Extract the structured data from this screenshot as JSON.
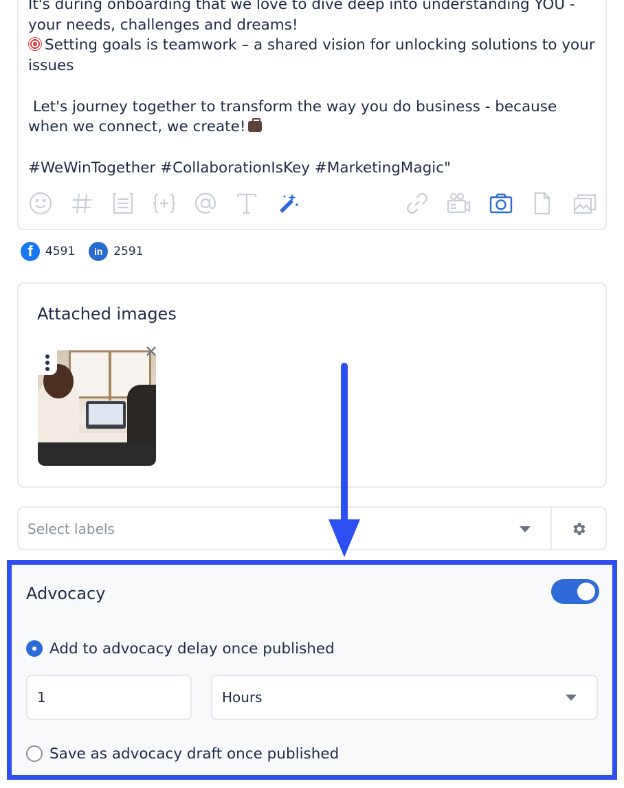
{
  "composer": {
    "text": "It's during onboarding that we love to dive deep into understanding YOU - your needs, challenges and dreams!\n",
    "goal_line": "Setting goals is teamwork – a shared vision for unlocking solutions to your issues\n\n Let's journey together to transform the way you do business - because when we connect, we create!",
    "hashtags": "#WeWinTogether #CollaborationIsKey #MarketingMagic\"",
    "toolbar_icons": [
      "emoji-icon",
      "hashtag-icon",
      "template-icon",
      "variable-icon",
      "mention-icon",
      "text-format-icon",
      "magic-wand-icon",
      "link-icon",
      "video-icon",
      "camera-icon",
      "document-icon",
      "gallery-icon"
    ]
  },
  "reach": {
    "facebook_count": "4591",
    "linkedin_count": "2591",
    "facebook_glyph": "f",
    "linkedin_glyph": "in"
  },
  "attached": {
    "title": "Attached images",
    "remove_glyph": "✕"
  },
  "labels": {
    "placeholder": "Select labels"
  },
  "advocacy": {
    "title": "Advocacy",
    "enabled": true,
    "option_delay": "Add to advocacy delay once published",
    "option_draft": "Save as advocacy draft once published",
    "selected_option": "delay",
    "delay_value": "1",
    "delay_unit": "Hours"
  },
  "colors": {
    "accent": "#2e6bd8",
    "highlight_border": "#2d4ef0",
    "facebook": "#1877f2"
  }
}
